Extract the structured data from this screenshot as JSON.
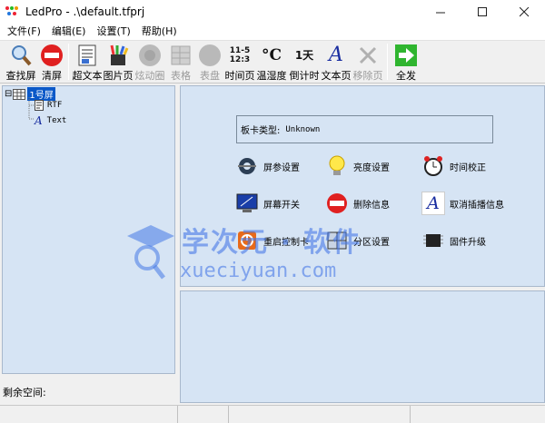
{
  "window": {
    "title": "LedPro - .\\default.tfprj"
  },
  "menu": [
    "文件(F)",
    "编辑(E)",
    "设置(T)",
    "帮助(H)"
  ],
  "toolbar": {
    "find_screen": "查找屏",
    "clear_screen": "清屏",
    "super_text": "超文本",
    "image_page": "图片页",
    "animation": "炫动圈",
    "table": "表格",
    "dial": "表盘",
    "time_page": "时间页",
    "temp_humidity": "温湿度",
    "countdown": "倒计时",
    "text_page": "文本页",
    "remove_page": "移除页",
    "send_all": "全发",
    "icon_time_top": "11-5",
    "icon_time_bottom": "12:3",
    "icon_temp": "°C",
    "icon_countdown": "1天",
    "icon_text": "A"
  },
  "tree": {
    "toggle": "⊟",
    "screen": "1号屏",
    "items": [
      "RTF",
      "Text"
    ]
  },
  "left_footer": {
    "free_space": "剩余空间:"
  },
  "card_info": {
    "label": "板卡类型:",
    "value": "Unknown"
  },
  "actions": {
    "screen_params": "屏参设置",
    "brightness": "亮度设置",
    "time_calibrate": "时间校正",
    "screen_switch": "屏幕开关",
    "delete_info": "删除信息",
    "cancel_insert": "取消插播信息",
    "restart_card": "重启控制卡",
    "zone_settings": "分区设置",
    "firmware_upgrade": "固件升级"
  },
  "watermark": {
    "cn": "学次元 · 软件",
    "en": "xueciyuan.com"
  }
}
